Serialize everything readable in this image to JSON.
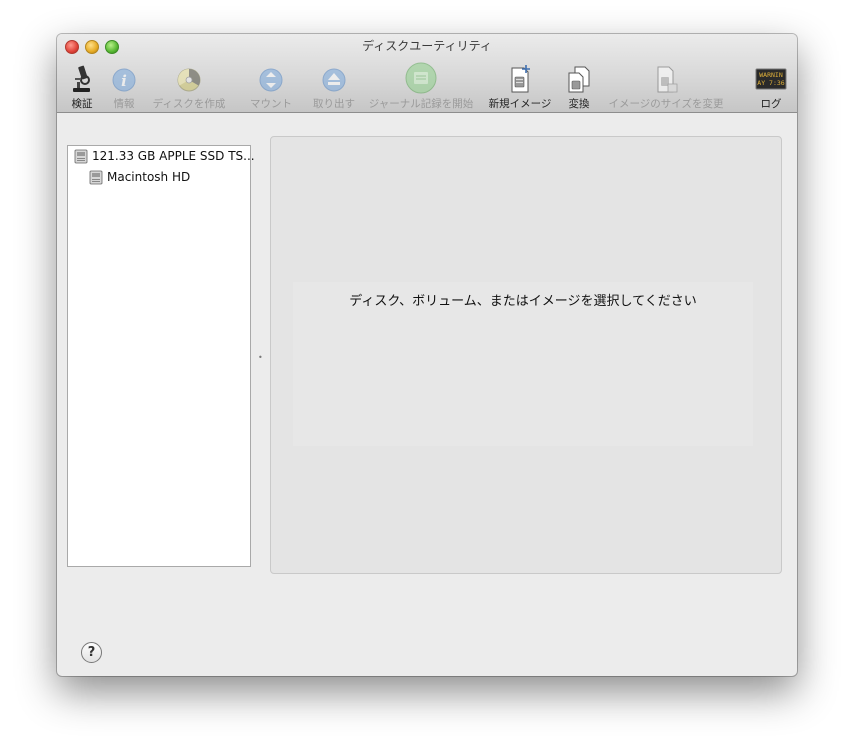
{
  "window": {
    "title": "ディスクユーティリティ"
  },
  "toolbar": {
    "items": [
      {
        "label": "検証",
        "icon": "microscope-icon",
        "enabled": true
      },
      {
        "label": "情報",
        "icon": "info-icon",
        "enabled": false
      },
      {
        "label": "ディスクを作成",
        "icon": "burn-disc-icon",
        "enabled": false
      },
      {
        "label": "マウント",
        "icon": "mount-icon",
        "enabled": false
      },
      {
        "label": "取り出す",
        "icon": "eject-icon",
        "enabled": false
      },
      {
        "label": "ジャーナル記録を開始",
        "icon": "journaling-icon",
        "enabled": false
      },
      {
        "label": "新規イメージ",
        "icon": "new-image-icon",
        "enabled": true
      },
      {
        "label": "変換",
        "icon": "convert-icon",
        "enabled": true
      },
      {
        "label": "イメージのサイズを変更",
        "icon": "resize-image-icon",
        "enabled": false
      },
      {
        "label": "ログ",
        "icon": "log-console-icon",
        "enabled": true
      }
    ],
    "log_icon_text": [
      "WARNIN",
      "AY 7:36"
    ]
  },
  "sidebar": {
    "disks": [
      {
        "label": "121.33 GB APPLE SSD TS...",
        "icon": "internal-disk-icon",
        "level": 0
      },
      {
        "label": "Macintosh HD",
        "icon": "volume-icon",
        "level": 1
      }
    ]
  },
  "detail": {
    "placeholder": "ディスク、ボリューム、またはイメージを選択してください"
  },
  "help": {
    "label": "?"
  },
  "colors": {
    "window_bg": "#ececec",
    "detail_bg": "#e4e4e4"
  }
}
